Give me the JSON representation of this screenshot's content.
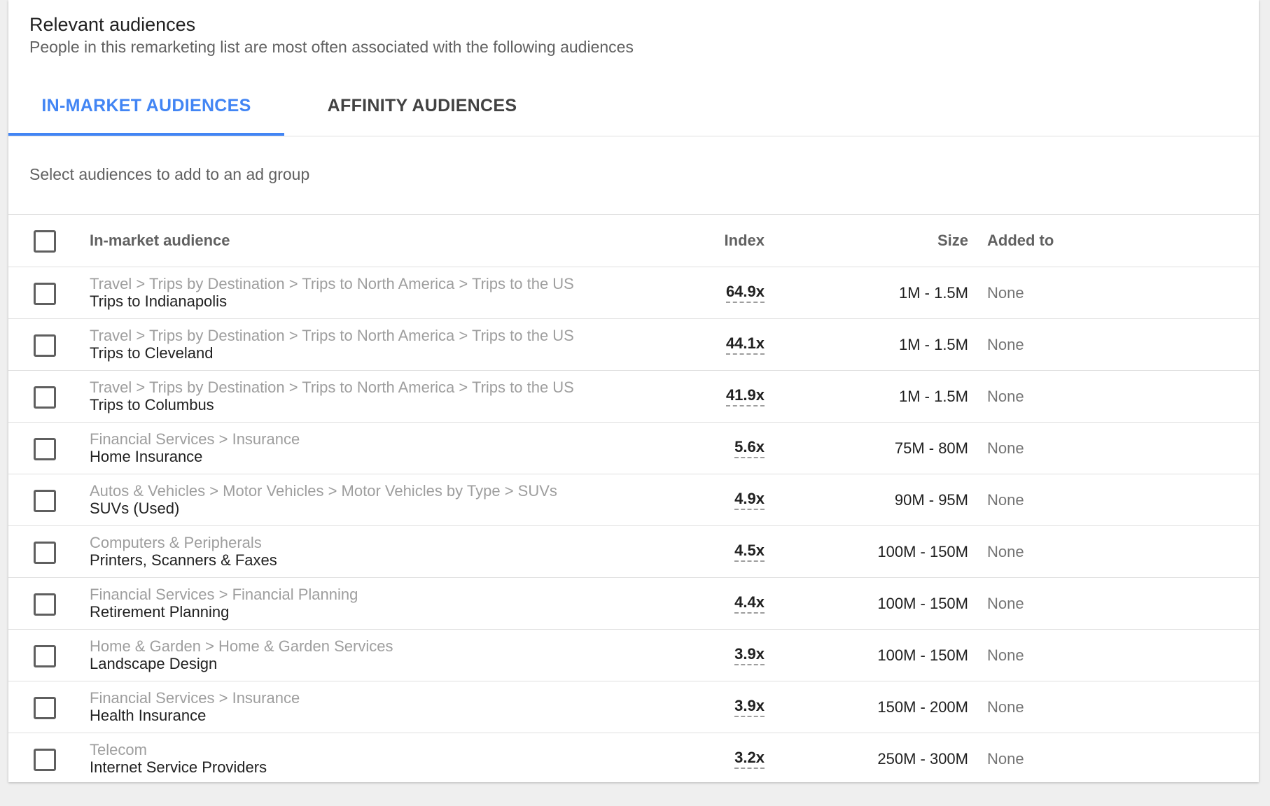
{
  "header": {
    "title": "Relevant audiences",
    "subtitle": "People in this remarketing list are most often associated with the following audiences"
  },
  "tabs": [
    {
      "label": "IN-MARKET AUDIENCES",
      "active": true
    },
    {
      "label": "AFFINITY AUDIENCES",
      "active": false
    }
  ],
  "hint": "Select audiences to add to an ad group",
  "table": {
    "columns": {
      "audience": "In-market audience",
      "index": "Index",
      "size": "Size",
      "added_to": "Added to"
    },
    "rows": [
      {
        "path": "Travel > Trips by Destination > Trips to North America > Trips to the US",
        "name": "Trips to Indianapolis",
        "index": "64.9x",
        "size": "1M - 1.5M",
        "added_to": "None"
      },
      {
        "path": "Travel > Trips by Destination > Trips to North America > Trips to the US",
        "name": "Trips to Cleveland",
        "index": "44.1x",
        "size": "1M - 1.5M",
        "added_to": "None"
      },
      {
        "path": "Travel > Trips by Destination > Trips to North America > Trips to the US",
        "name": "Trips to Columbus",
        "index": "41.9x",
        "size": "1M - 1.5M",
        "added_to": "None"
      },
      {
        "path": "Financial Services > Insurance",
        "name": "Home Insurance",
        "index": "5.6x",
        "size": "75M - 80M",
        "added_to": "None"
      },
      {
        "path": "Autos & Vehicles > Motor Vehicles > Motor Vehicles by Type > SUVs",
        "name": "SUVs (Used)",
        "index": "4.9x",
        "size": "90M - 95M",
        "added_to": "None"
      },
      {
        "path": "Computers & Peripherals",
        "name": "Printers, Scanners & Faxes",
        "index": "4.5x",
        "size": "100M - 150M",
        "added_to": "None"
      },
      {
        "path": "Financial Services > Financial Planning",
        "name": "Retirement Planning",
        "index": "4.4x",
        "size": "100M - 150M",
        "added_to": "None"
      },
      {
        "path": "Home & Garden > Home & Garden Services",
        "name": "Landscape Design",
        "index": "3.9x",
        "size": "100M - 150M",
        "added_to": "None"
      },
      {
        "path": "Financial Services > Insurance",
        "name": "Health Insurance",
        "index": "3.9x",
        "size": "150M - 200M",
        "added_to": "None"
      },
      {
        "path": "Telecom",
        "name": "Internet Service Providers",
        "index": "3.2x",
        "size": "250M - 300M",
        "added_to": "None"
      }
    ]
  },
  "colors": {
    "accent": "#4285f4",
    "text_primary": "#212121",
    "text_secondary": "#616161",
    "text_muted": "#9e9e9e"
  }
}
